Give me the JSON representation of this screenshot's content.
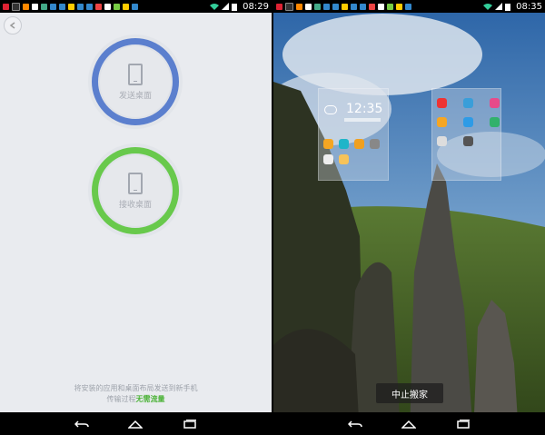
{
  "left_screen": {
    "status": {
      "time": "08:29"
    },
    "send_label": "发送桌面",
    "receive_label": "接收桌面",
    "note_line1": "将安装的应用和桌面布局发送到新手机",
    "note_line2_prefix": "传输过程",
    "note_line2_highlight": "无需流量",
    "colors": {
      "send_ring": "#5b7fce",
      "receive_ring": "#68c94c",
      "highlight": "#4db33a"
    }
  },
  "right_screen": {
    "status": {
      "time": "08:35"
    },
    "clock_widget_time": "12:35",
    "stop_button_label": "中止搬家"
  }
}
